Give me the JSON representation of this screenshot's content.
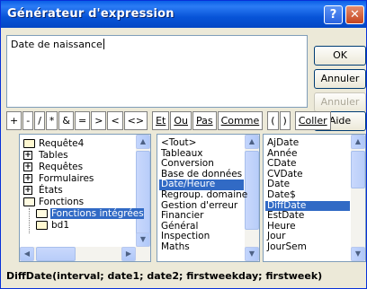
{
  "window": {
    "title": "Générateur d'expression",
    "help_glyph": "?",
    "close_glyph": "✕"
  },
  "expression": {
    "value": "Date de naissance"
  },
  "buttons": {
    "ok": "OK",
    "cancel": "Annuler",
    "undo": "Annuler",
    "help": "Aide"
  },
  "operators": [
    "+",
    "-",
    "/",
    "*",
    "&",
    "=",
    ">",
    "<",
    "<>",
    "Et",
    "Ou",
    "Pas",
    "Comme",
    "(",
    ")",
    "Coller"
  ],
  "tree": {
    "items": [
      {
        "label": "Requête4",
        "icon": "folder-icon"
      },
      {
        "label": "Tables",
        "icon": "expand-icon"
      },
      {
        "label": "Requêtes",
        "icon": "expand-icon"
      },
      {
        "label": "Formulaires",
        "icon": "expand-icon"
      },
      {
        "label": "États",
        "icon": "expand-icon"
      },
      {
        "label": "Fonctions",
        "icon": "open-folder-icon"
      },
      {
        "label": "Fonctions intégrées",
        "icon": "open-folder-icon",
        "selected": true
      },
      {
        "label": "bd1",
        "icon": "folder-icon"
      }
    ]
  },
  "categories": {
    "items": [
      "<Tout>",
      "Tableaux",
      "Conversion",
      "Base de données",
      "Date/Heure",
      "Regroup. domaine",
      "Gestion d'erreur",
      "Financier",
      "Général",
      "Inspection",
      "Maths"
    ],
    "selected": "Date/Heure"
  },
  "functions": {
    "items": [
      "AjDate",
      "Année",
      "CDate",
      "CVDate",
      "Date",
      "Date$",
      "DiffDate",
      "EstDate",
      "Heure",
      "Jour",
      "JourSem"
    ],
    "selected": "DiffDate"
  },
  "signature": "DiffDate(interval; date1; date2; firstweekday; firstweek)",
  "colors": {
    "titlebar": "#0754d8",
    "selection": "#316ac5",
    "dialog": "#ece9d8"
  }
}
